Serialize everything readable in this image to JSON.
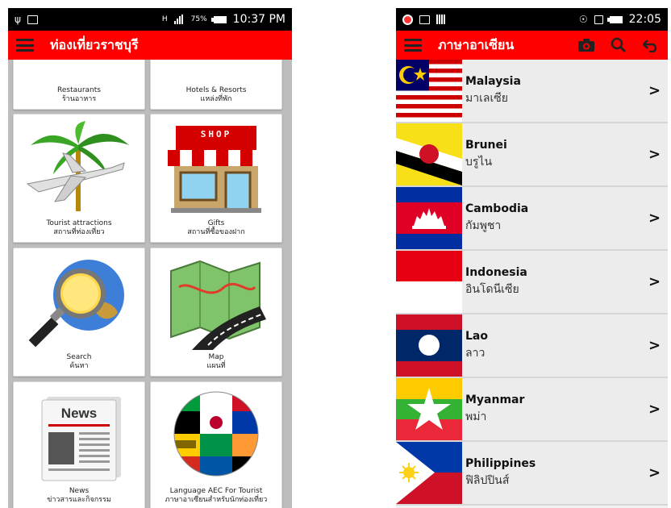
{
  "left": {
    "status": {
      "time": "10:37 PM",
      "battery": "75%",
      "net": "H"
    },
    "title": "ท่องเที่ยวราชบุรี",
    "tiles": [
      {
        "en": "Restaurants",
        "th": "ร้านอาหาร"
      },
      {
        "en": "Hotels & Resorts",
        "th": "แหล่งที่พัก"
      },
      {
        "en": "Tourist attractions",
        "th": "สถานที่ท่องเที่ยว"
      },
      {
        "en": "Gifts",
        "th": "สถานที่ซื้อของฝาก"
      },
      {
        "en": "Search",
        "th": "ค้นหา"
      },
      {
        "en": "Map",
        "th": "แผนที่"
      },
      {
        "en": "News",
        "th": "ข่าวสารและกิจกรรม"
      },
      {
        "en": "Language AEC For Tourist",
        "th": "ภาษาอาเซียนสำหรับนักท่องเที่ยว"
      }
    ],
    "shop_sign": "SHOP",
    "news_sign": "News"
  },
  "right": {
    "status": {
      "time": "22:05"
    },
    "title": "ภาษาอาเซียน",
    "countries": [
      {
        "en": "Malaysia",
        "th": "มาเลเซีย"
      },
      {
        "en": "Brunei",
        "th": "บรูไน"
      },
      {
        "en": "Cambodia",
        "th": "กัมพูชา"
      },
      {
        "en": "Indonesia",
        "th": "อินโดนีเซีย"
      },
      {
        "en": "Lao",
        "th": "ลาว"
      },
      {
        "en": "Myanmar",
        "th": "พม่า"
      },
      {
        "en": "Philippines",
        "th": "ฟิลิปปินส์"
      }
    ],
    "chevron": ">"
  },
  "colors": {
    "appbar": "#ff0000",
    "statusbar": "#000000"
  }
}
